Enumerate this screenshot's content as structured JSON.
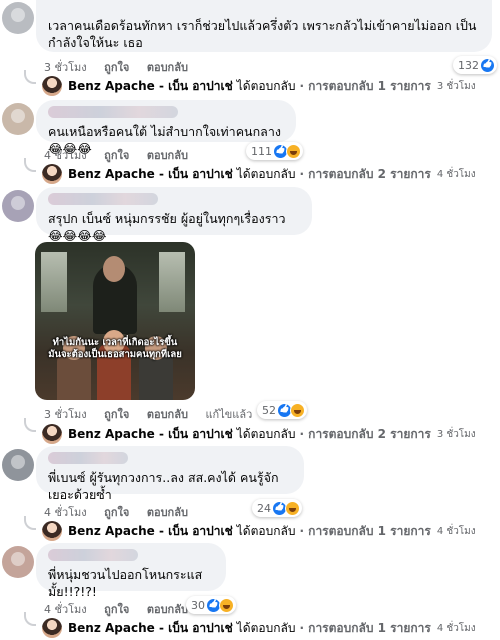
{
  "meta_labels": {
    "like": "ถูกใจ",
    "reply": "ตอบกลับ",
    "edited": "แก้ไขแล้ว"
  },
  "reply_author": "Benz Apache - เบ็น อาปาเช่",
  "reply_action": "ได้ตอบกลับ",
  "comments": [
    {
      "text": "เวลาคนเดือดร้อนทักหา เราก็ช่วยไปแล้วครึ่งตัว เพราะกลัวไม่เข้าคายไม่ออก เป็นกำลังใจให้นะ เธอ",
      "time": "3 ชั่วโมง",
      "reaction_count": "132",
      "reply_summary": "· การตอบกลับ 1 รายการ",
      "reply_time": "3 ชั่วโมง"
    },
    {
      "text": "คนเหนือหรือคนใต้ ไม่สำบากใจเท่าคนกลาง 😂😂😂",
      "time": "4 ชั่วโมง",
      "reaction_count": "111",
      "reply_summary": "· การตอบกลับ 2 รายการ",
      "reply_time": "4 ชั่วโมง"
    },
    {
      "text": "สรุปก เบ็นซ์ หนุ่มกรรชัย ผู้อยู่ในทุกๆเรื่องราว 😂😂😂😂",
      "image_caption": "ทำไมกันนะ เวลาที่เกิดอะไรขึ้น มันจะต้องเป็นเธอสามคนทุกทีเลย",
      "time": "3 ชั่วโมง",
      "reaction_count": "52",
      "reply_summary": "· การตอบกลับ 2 รายการ",
      "reply_time": "3 ชั่วโมง"
    },
    {
      "text": "พี่เบนซ์ ผู้รันทุกวงการ..ลง สส.คงได้ คนรู้จักเยอะด้วยซ้ำ",
      "time": "4 ชั่วโมง",
      "reaction_count": "24",
      "reply_summary": "· การตอบกลับ 1 รายการ",
      "reply_time": "4 ชั่วโมง"
    },
    {
      "text": "พี่หนุ่มชวนไปออกโหนกระแสมั้ย!!?!?!",
      "time": "4 ชั่วโมง",
      "reaction_count": "30",
      "reply_summary": "· การตอบกลับ 1 รายการ",
      "reply_time": "4 ชั่วโมง"
    }
  ]
}
